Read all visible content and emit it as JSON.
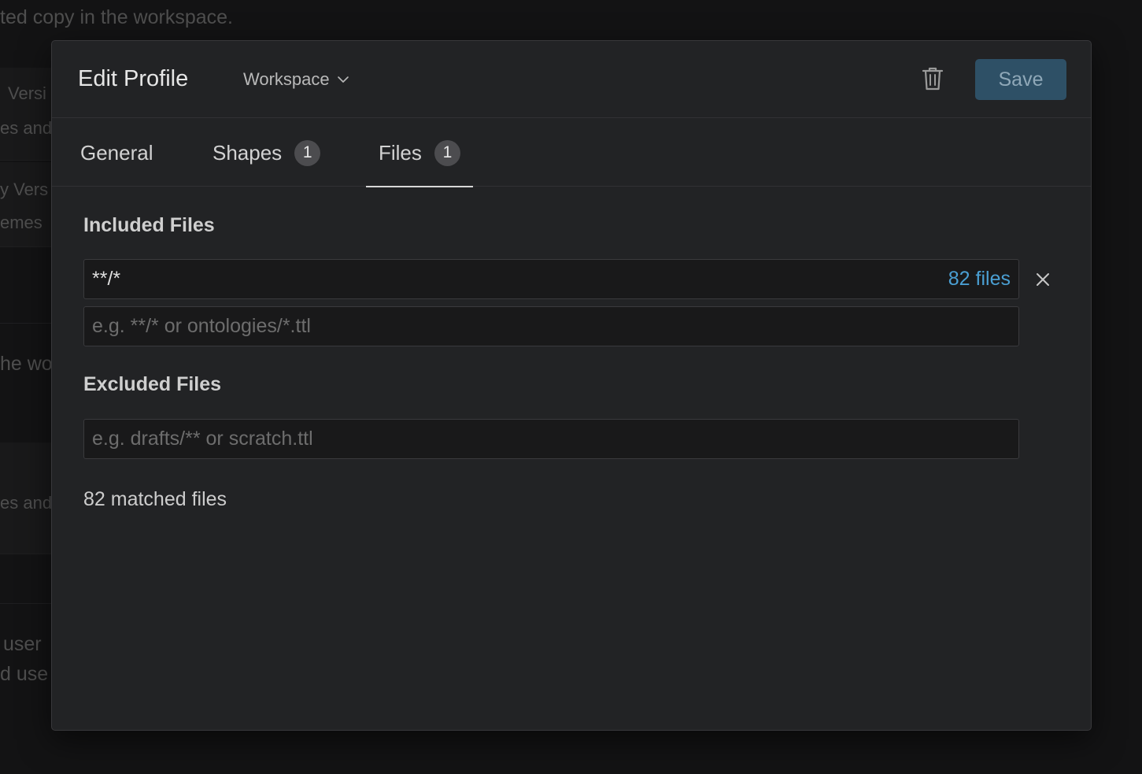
{
  "background": {
    "lines": [
      {
        "text": "ted copy in the workspace."
      },
      {
        "text": "Versi"
      },
      {
        "text": "es and"
      },
      {
        "text": "y  Vers"
      },
      {
        "text": "emes"
      },
      {
        "text": "he wo"
      },
      {
        "text": "es and"
      },
      {
        "text": "user"
      },
      {
        "text": "d use"
      }
    ]
  },
  "modal": {
    "title": "Edit Profile",
    "scope_label": "Workspace",
    "save_label": "Save",
    "tabs": [
      {
        "label": "General"
      },
      {
        "label": "Shapes",
        "badge": "1"
      },
      {
        "label": "Files",
        "badge": "1",
        "active": true
      }
    ],
    "included": {
      "label": "Included Files",
      "patterns": [
        {
          "value": "**/*",
          "count": "82 files"
        }
      ],
      "placeholder": "e.g. **/* or ontologies/*.ttl"
    },
    "excluded": {
      "label": "Excluded Files",
      "placeholder": "e.g. drafts/** or scratch.ttl"
    },
    "matched_summary": "82 matched files"
  },
  "colors": {
    "accent": "#4a9fd3",
    "save_button": "#2e5066"
  },
  "icons": {
    "scope_dropdown": "chevron-down-icon",
    "delete": "trash-icon",
    "remove_pattern": "close-icon"
  }
}
